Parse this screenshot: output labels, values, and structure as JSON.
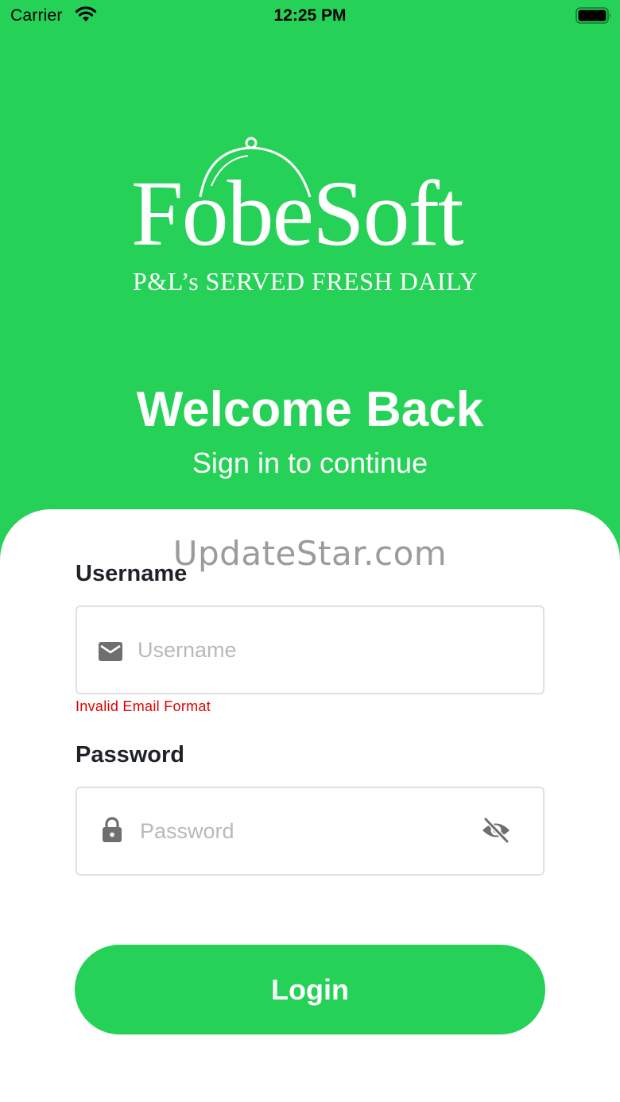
{
  "status_bar": {
    "carrier": "Carrier",
    "time": "12:25 PM"
  },
  "logo": {
    "name": "FobeSoft",
    "tagline": "P&L’s SERVED FRESH DAILY"
  },
  "header": {
    "title": "Welcome Back",
    "subtitle": "Sign in to continue"
  },
  "watermark": "UpdateStar.com",
  "form": {
    "username": {
      "label": "Username",
      "placeholder": "Username",
      "value": "",
      "icon": "mail-icon",
      "error": "Invalid Email Format"
    },
    "password": {
      "label": "Password",
      "placeholder": "Password",
      "value": "",
      "icon": "lock-icon",
      "toggle_icon": "eye-off-icon"
    },
    "submit_label": "Login"
  },
  "colors": {
    "brand_green": "#26D158",
    "error_red": "#E00000",
    "text_dark": "#1F2329"
  }
}
